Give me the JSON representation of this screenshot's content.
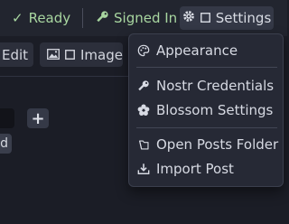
{
  "status": {
    "ready_label": "Ready",
    "signed_in_label": "Signed In",
    "settings_label": "Settings"
  },
  "toolbar": {
    "edit_label": "Edit",
    "image_label": "Image"
  },
  "left": {
    "plus_label": "+",
    "chip_label": "d"
  },
  "menu": {
    "appearance": "Appearance",
    "nostr_credentials": "Nostr Credentials",
    "blossom_settings": "Blossom Settings",
    "open_posts_folder": "Open Posts Folder",
    "import_post": "Import Post"
  },
  "colors": {
    "status_green": "#a8d6a0",
    "menu_bg": "#262935",
    "app_bg": "#1b1d26"
  }
}
